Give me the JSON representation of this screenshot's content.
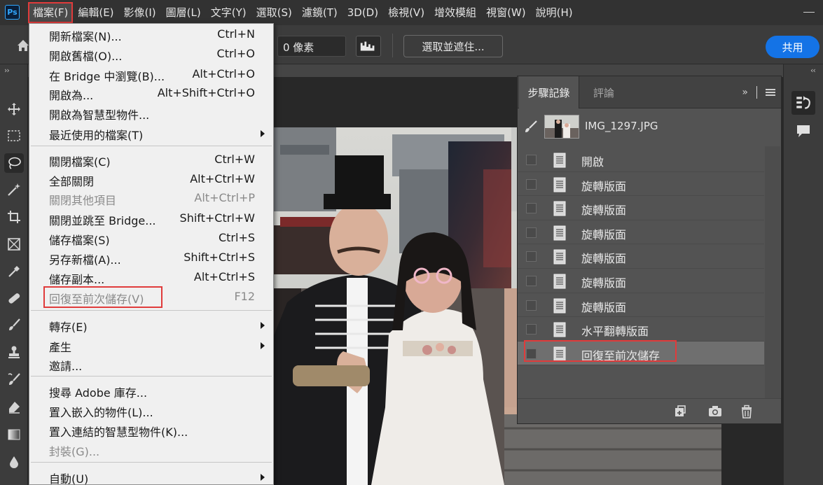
{
  "app": {
    "logo": "Ps",
    "menus": [
      "檔案(F)",
      "編輯(E)",
      "影像(I)",
      "圖層(L)",
      "文字(Y)",
      "選取(S)",
      "濾鏡(T)",
      "3D(D)",
      "檢視(V)",
      "增效模組",
      "視窗(W)",
      "說明(H)"
    ]
  },
  "options": {
    "feather_value": "0 像素",
    "select_mask": "選取並遮住...",
    "share": "共用"
  },
  "file_menu": {
    "items": [
      {
        "label": "開新檔案(N)...",
        "shortcut": "Ctrl+N"
      },
      {
        "label": "開啟舊檔(O)...",
        "shortcut": "Ctrl+O"
      },
      {
        "label": "在 Bridge 中瀏覽(B)...",
        "shortcut": "Alt+Ctrl+O"
      },
      {
        "label": "開啟為...",
        "shortcut": "Alt+Shift+Ctrl+O"
      },
      {
        "label": "開啟為智慧型物件...",
        "shortcut": ""
      },
      {
        "label": "最近使用的檔案(T)",
        "shortcut": ""
      },
      {
        "label": "關閉檔案(C)",
        "shortcut": "Ctrl+W"
      },
      {
        "label": "全部關閉",
        "shortcut": "Alt+Ctrl+W"
      },
      {
        "label": "關閉其他項目",
        "shortcut": "Alt+Ctrl+P"
      },
      {
        "label": "關閉並跳至 Bridge...",
        "shortcut": "Shift+Ctrl+W"
      },
      {
        "label": "儲存檔案(S)",
        "shortcut": "Ctrl+S"
      },
      {
        "label": "另存新檔(A)...",
        "shortcut": "Shift+Ctrl+S"
      },
      {
        "label": "儲存副本...",
        "shortcut": "Alt+Ctrl+S"
      },
      {
        "label": "回復至前次儲存(V)",
        "shortcut": "F12"
      },
      {
        "label": "轉存(E)",
        "shortcut": ""
      },
      {
        "label": "產生",
        "shortcut": ""
      },
      {
        "label": "邀請...",
        "shortcut": ""
      },
      {
        "label": "搜尋 Adobe 庫存...",
        "shortcut": ""
      },
      {
        "label": "置入嵌入的物件(L)...",
        "shortcut": ""
      },
      {
        "label": "置入連結的智慧型物件(K)...",
        "shortcut": ""
      },
      {
        "label": "封裝(G)...",
        "shortcut": ""
      },
      {
        "label": "自動(U)",
        "shortcut": ""
      }
    ]
  },
  "history_panel": {
    "tab_active": "步驟記錄",
    "tab_inactive": "評論",
    "more": "»",
    "snapshot_label": "IMG_1297.JPG",
    "steps": [
      "開啟",
      "旋轉版面",
      "旋轉版面",
      "旋轉版面",
      "旋轉版面",
      "旋轉版面",
      "旋轉版面",
      "水平翻轉版面",
      "回復至前次儲存"
    ]
  }
}
